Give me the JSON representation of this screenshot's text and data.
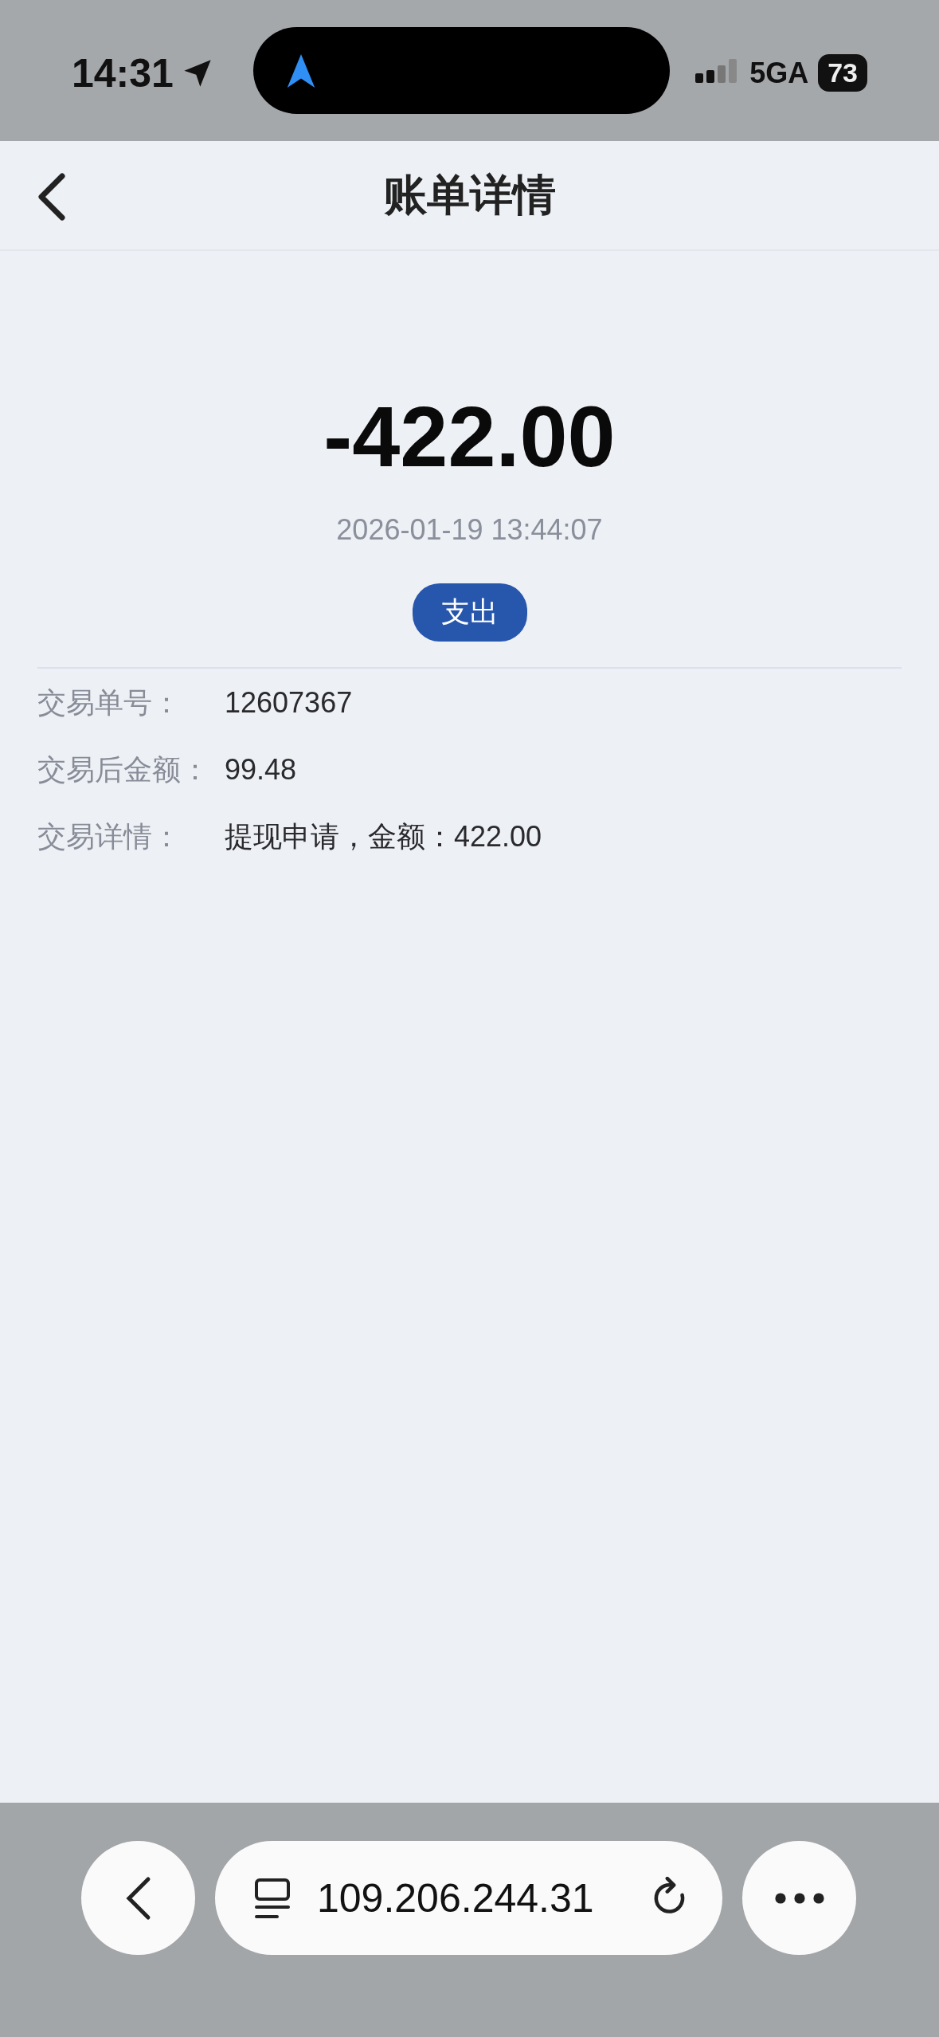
{
  "status_bar": {
    "time": "14:31",
    "network": "5GA",
    "battery": "73"
  },
  "header": {
    "title": "账单详情"
  },
  "summary": {
    "amount": "-422.00",
    "datetime": "2026-01-19 13:44:07",
    "type_badge": "支出"
  },
  "details": [
    {
      "label": "交易单号：",
      "value": "12607367"
    },
    {
      "label": "交易后金额：",
      "value": "99.48"
    },
    {
      "label": "交易详情：",
      "value": "提现申请，金额：422.00"
    }
  ],
  "browser_bar": {
    "url": "109.206.244.31"
  }
}
